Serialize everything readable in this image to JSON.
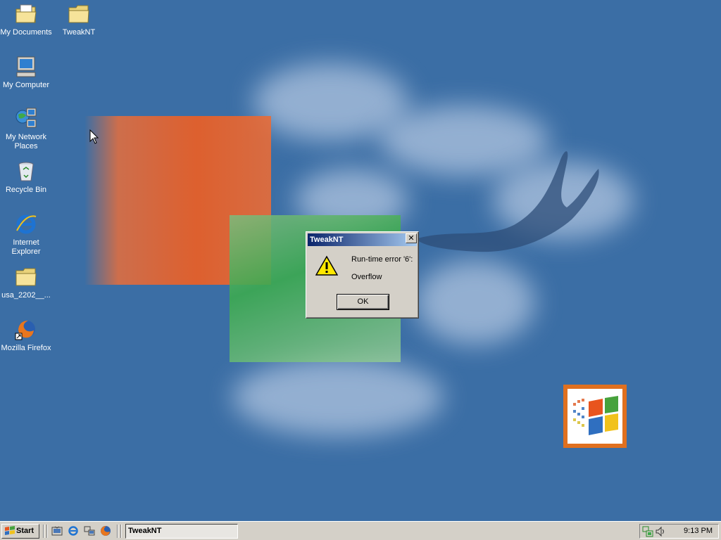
{
  "desktop": {
    "icons": [
      {
        "label": "My Documents",
        "icon": "my-documents-icon"
      },
      {
        "label": "TweakNT",
        "icon": "folder-icon"
      },
      {
        "label": "My Computer",
        "icon": "my-computer-icon"
      },
      {
        "label": "My Network Places",
        "icon": "network-places-icon"
      },
      {
        "label": "Recycle Bin",
        "icon": "recycle-bin-icon"
      },
      {
        "label": "Internet Explorer",
        "icon": "internet-explorer-icon"
      },
      {
        "label": "usa_2202__...",
        "icon": "folder-icon"
      },
      {
        "label": "Mozilla Firefox",
        "icon": "firefox-icon"
      }
    ],
    "background_color": "#3b6ea5"
  },
  "dialog": {
    "title": "TweakNT",
    "close_label": "✕",
    "message_line1": "Run-time error '6':",
    "message_line2": "Overflow",
    "ok_label": "OK",
    "icon": "warning-icon"
  },
  "taskbar": {
    "start_label": "Start",
    "quick_launch": [
      "show-desktop-icon",
      "internet-explorer-icon",
      "network-icon",
      "firefox-icon"
    ],
    "tasks": [
      {
        "label": "TweakNT"
      }
    ],
    "clock": "9:13 PM",
    "tray_icons": [
      "network-status-icon",
      "volume-icon"
    ]
  },
  "colors": {
    "titlebar_start": "#0a246a",
    "titlebar_end": "#a6caf0",
    "face": "#d4d0c8"
  }
}
